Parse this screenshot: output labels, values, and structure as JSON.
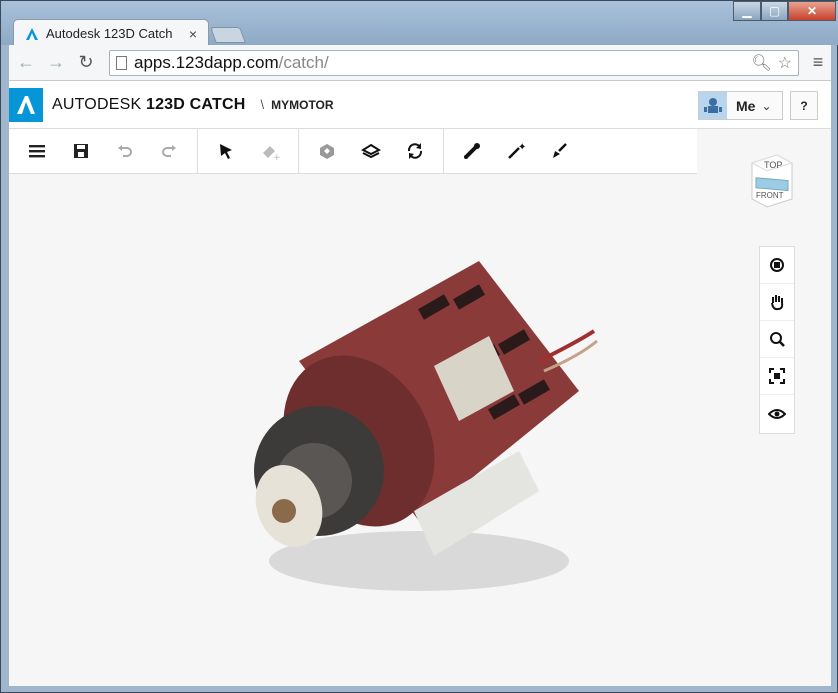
{
  "browser": {
    "tab_title": "Autodesk 123D Catch",
    "tab_close_label": "×",
    "url_host": "apps.123dapp.com",
    "url_path": "/catch/"
  },
  "app": {
    "brand_prefix": "AUTODESK",
    "brand_product": "123D CATCH",
    "crumb_separator": "\\",
    "project_name": "MYMOTOR",
    "user_label": "Me",
    "help_label": "?"
  },
  "viewcube": {
    "top_label": "TOP",
    "front_label": "FRONT"
  },
  "toolbar": {
    "groups": [
      [
        "menu-icon",
        "save-icon",
        "undo-icon",
        "redo-icon"
      ],
      [
        "select-arrow-icon",
        "eraser-icon"
      ],
      [
        "export-icon",
        "layers-icon",
        "sync-icon"
      ],
      [
        "measure-icon",
        "magic-wand-icon",
        "paint-brush-icon"
      ]
    ]
  },
  "sidenav": [
    "orbit-icon",
    "pan-hand-icon",
    "zoom-icon",
    "fit-to-view-icon",
    "visibility-eye-icon"
  ],
  "colors": {
    "autodesk_blue": "#0696d7",
    "motor_red": "#8b3a3a"
  }
}
